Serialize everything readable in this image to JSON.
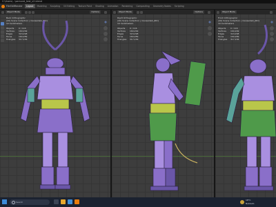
{
  "window": {
    "title": "C:\\Users\\...\\samurai_test_v2.blend"
  },
  "menu": {
    "items": [
      "File",
      "Edit",
      "Render",
      "Window",
      "Help"
    ],
    "tabs": [
      "Layout",
      "Modeling",
      "Sculpting",
      "UV Editing",
      "Texture Paint",
      "Shading",
      "Animation",
      "Rendering",
      "Compositing",
      "Geometry Nodes",
      "Scripting"
    ],
    "active_tab": "Layout"
  },
  "viewports": [
    {
      "mode": "Object Mode",
      "options": "Options",
      "view_name": "Back Orthographic",
      "collection": "(40) Scene Collection | manaside0_[RD]",
      "units": "10 Centimeters",
      "stats": [
        [
          "Objects",
          "0 / 116"
        ],
        [
          "Vertices",
          "160,299"
        ],
        [
          "Edges",
          "324,298"
        ],
        [
          "Faces",
          "160,289"
        ],
        [
          "Triangles",
          "317,156"
        ]
      ]
    },
    {
      "mode": "Object Mode",
      "options": "Options",
      "view_name": "Right Orthographic",
      "collection": "(40) Scene Collection | manaside0_[RD]",
      "units": "10 Centimeters",
      "stats": [
        [
          "Objects",
          "0 / 116"
        ],
        [
          "Vertices",
          "160,299"
        ],
        [
          "Edges",
          "324,298"
        ],
        [
          "Faces",
          "160,289"
        ],
        [
          "Triangles",
          "317,156"
        ]
      ]
    },
    {
      "mode": "Object Mode",
      "options": "Options",
      "view_name": "Front Orthographic",
      "collection": "(40) Scene Collection | manaside0_[RD]",
      "units": "10 Centimeters",
      "stats": [
        [
          "Objects",
          "0 / 116"
        ],
        [
          "Vertices",
          "160,299"
        ],
        [
          "Edges",
          "324,298"
        ],
        [
          "Faces",
          "160,289"
        ],
        [
          "Triangles",
          "317,156"
        ]
      ]
    }
  ],
  "taskbar": {
    "search_placeholder": "Search",
    "weather_temp": "18°C",
    "weather_desc": "Nublado"
  },
  "colors": {
    "armor": "#8a6fc9",
    "armor_light": "#a98fe0",
    "sash": "#b9c64a",
    "accent_green": "#4f9a4a",
    "accent_teal": "#5aa39a",
    "horn": "#6a56a8",
    "viewport_bg": "#3d3d3d"
  }
}
